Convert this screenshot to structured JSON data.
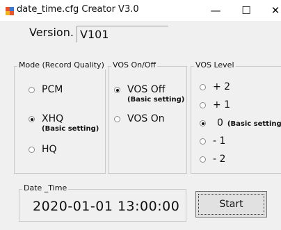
{
  "window": {
    "title": "date_time.cfg Creator V3.0",
    "icon": "app-config-icon",
    "controls": {
      "minimize": "—",
      "maximize": "☐",
      "close": "✕"
    }
  },
  "version": {
    "label": "Version.",
    "value": "V101"
  },
  "mode_group": {
    "legend": "Mode (Record Quality)",
    "options": [
      {
        "label": "PCM",
        "sub": "",
        "checked": false
      },
      {
        "label": "XHQ",
        "sub": "(Basic setting)",
        "checked": true
      },
      {
        "label": "HQ",
        "sub": "",
        "checked": false
      }
    ]
  },
  "vos_group": {
    "legend": "VOS On/Off",
    "options": [
      {
        "label": "VOS Off",
        "sub": "(Basic setting)",
        "checked": true
      },
      {
        "label": "VOS On",
        "sub": "",
        "checked": false
      }
    ]
  },
  "level_group": {
    "legend": "VOS Level",
    "options": [
      {
        "label": "+ 2",
        "sub": "",
        "checked": false
      },
      {
        "label": "+ 1",
        "sub": "",
        "checked": false
      },
      {
        "label": "0",
        "sub": "(Basic setting)",
        "checked": true
      },
      {
        "label": "- 1",
        "sub": "",
        "checked": false
      },
      {
        "label": "- 2",
        "sub": "",
        "checked": false
      }
    ]
  },
  "date_group": {
    "legend": "Date _Time",
    "value": "2020-01-01 13:00:00"
  },
  "start_button": {
    "label": "Start"
  },
  "colors": {
    "window_bg": "#f0f0f0",
    "titlebar_bg": "#ffffff",
    "button_bg": "#e1e1e1"
  }
}
